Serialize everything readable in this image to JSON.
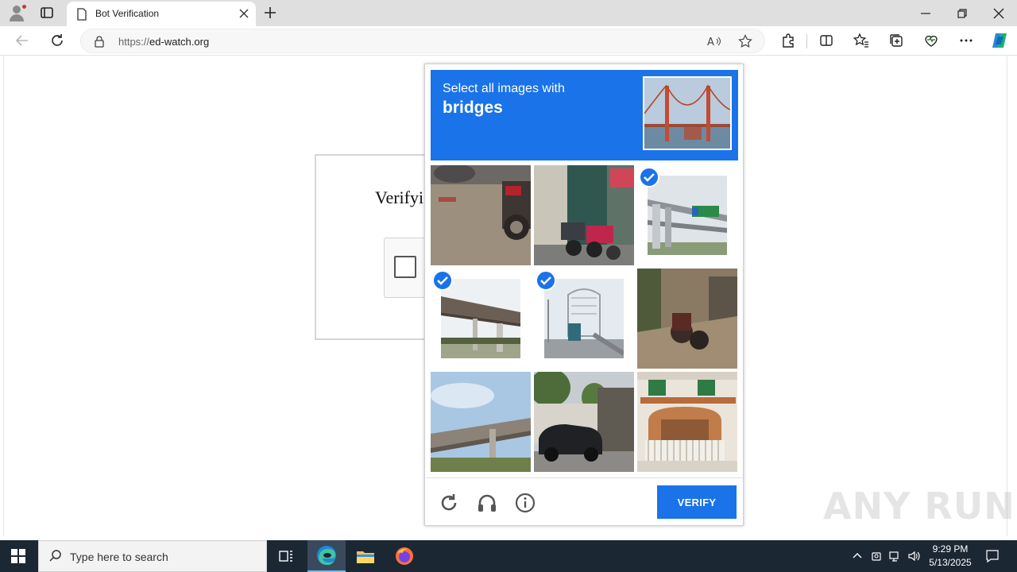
{
  "browser": {
    "tab_title": "Bot Verification",
    "url_scheme": "https://",
    "url_host": "ed-watch.org"
  },
  "page": {
    "heading": "Verifyi"
  },
  "captcha": {
    "prompt": "Select all images with",
    "keyword": "bridges",
    "verify_label": "VERIFY",
    "tiles": [
      {
        "subject": "pavement-motorbike",
        "selected": false
      },
      {
        "subject": "shopfront-scooters",
        "selected": false
      },
      {
        "subject": "highway-overpass-sign",
        "selected": true
      },
      {
        "subject": "overpass-underside",
        "selected": true
      },
      {
        "subject": "bridge-road-truck",
        "selected": true
      },
      {
        "subject": "courtyard-motorbike",
        "selected": false
      },
      {
        "subject": "overpass-sky",
        "selected": false
      },
      {
        "subject": "house-parked-car",
        "selected": false
      },
      {
        "subject": "villa-balcony",
        "selected": false
      }
    ],
    "colors": {
      "accent": "#1a73e8"
    }
  },
  "watermark": "ANY RUN",
  "taskbar": {
    "search_placeholder": "Type here to search",
    "time": "9:29 PM",
    "date": "5/13/2025"
  },
  "icons": [
    "profile-icon",
    "tab-actions-icon",
    "page-icon",
    "close-tab-icon",
    "new-tab-icon",
    "minimize-icon",
    "restore-icon",
    "close-window-icon",
    "back-icon",
    "refresh-icon",
    "lock-icon",
    "read-aloud-icon",
    "favorite-star-icon",
    "extensions-icon",
    "split-screen-icon",
    "favorites-icon",
    "collections-icon",
    "performance-icon",
    "more-icon",
    "copilot-icon",
    "reload-challenge-icon",
    "audio-challenge-icon",
    "info-icon",
    "windows-start-icon",
    "search-icon",
    "task-view-icon",
    "edge-icon",
    "file-explorer-icon",
    "firefox-icon",
    "chevron-up-icon",
    "network-icon",
    "volume-icon",
    "notification-icon"
  ]
}
